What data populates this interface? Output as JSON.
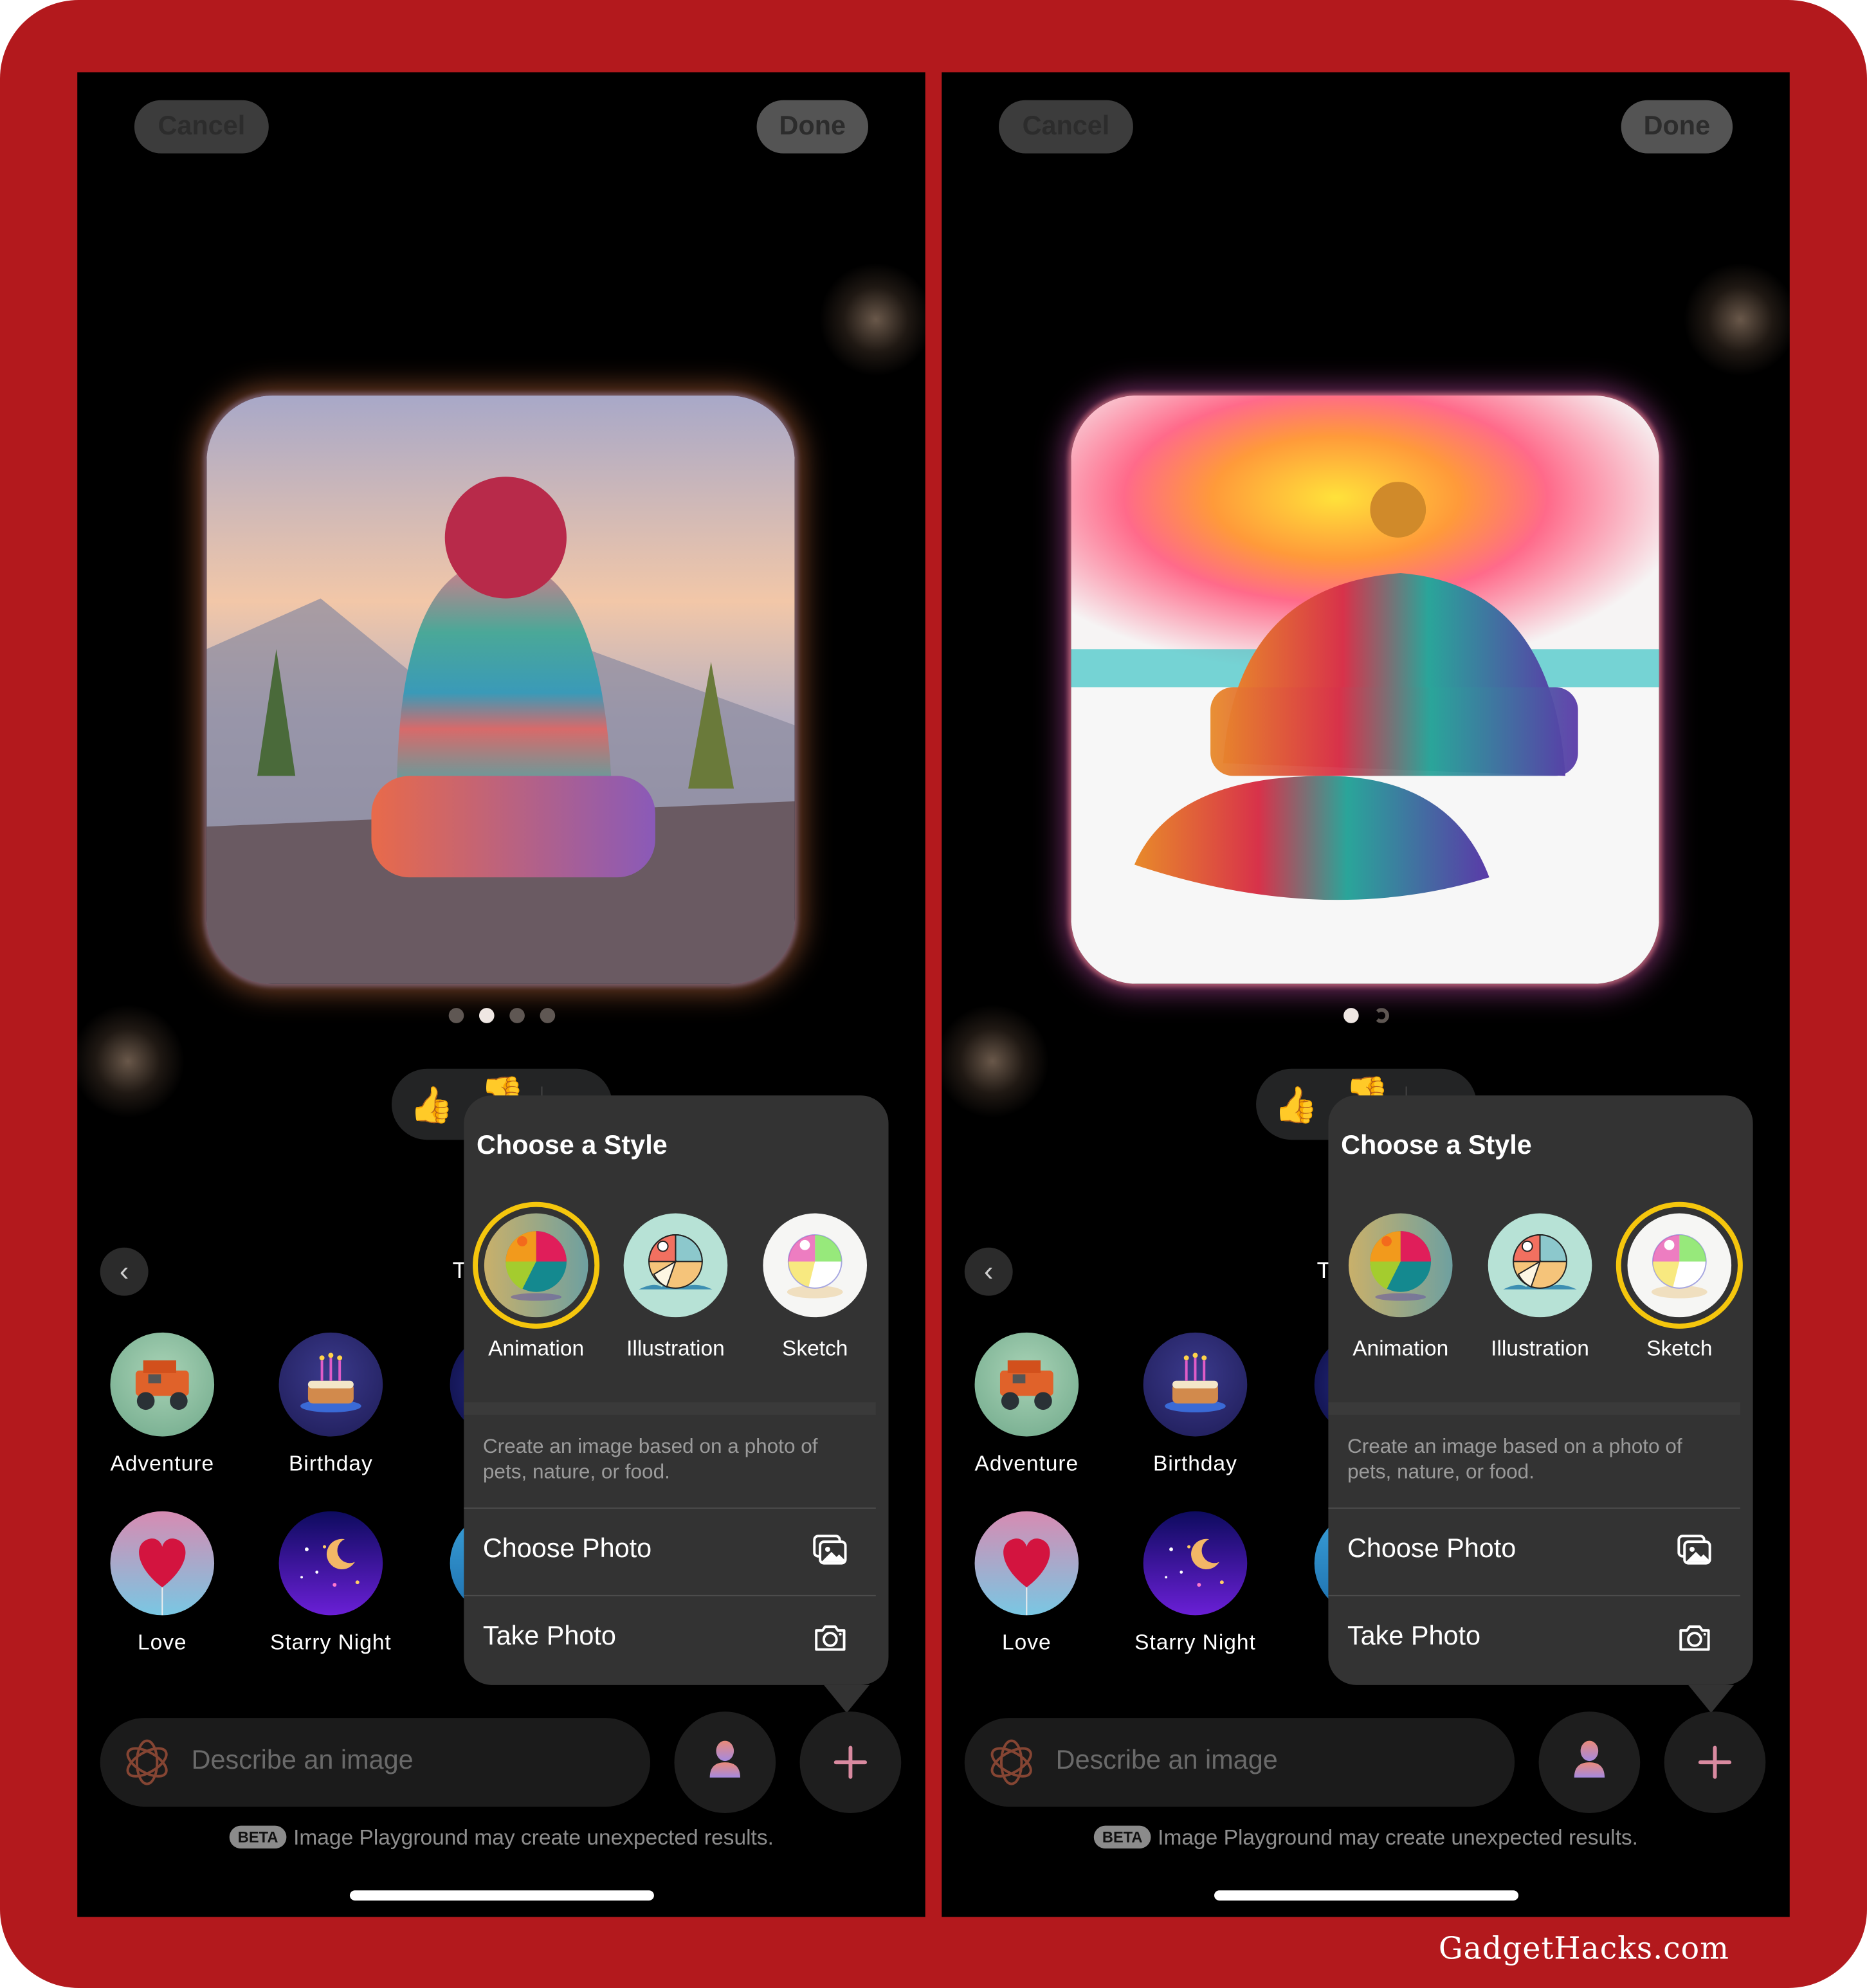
{
  "watermark": "GadgetHacks.com",
  "colors": {
    "frame": "#b3191d",
    "selection_ring": "#f5c60d",
    "popover_bg": "#333333"
  },
  "screens": [
    {
      "id": "left",
      "top_bar": {
        "cancel_label": "Cancel",
        "done_label": "Done"
      },
      "generated_image": {
        "subject": "knitted beanie with pom-pom on wooden table, mountain sunset",
        "style": "Animation"
      },
      "pager": {
        "count": 4,
        "active_index": 1,
        "loading": false
      },
      "feedback": {
        "like_icon": "thumbs-up-icon",
        "dislike_icon": "thumbs-down-icon"
      },
      "category_partial_label": "T",
      "themes": [
        {
          "label": "Adventure"
        },
        {
          "label": "Birthday"
        },
        {
          "label": "Love"
        },
        {
          "label": "Starry Night"
        }
      ],
      "popover": {
        "title": "Choose a Style",
        "styles": [
          {
            "label": "Animation",
            "selected": true
          },
          {
            "label": "Illustration",
            "selected": false
          },
          {
            "label": "Sketch",
            "selected": false
          }
        ],
        "description": "Create an image based on a photo of pets, nature, or food.",
        "actions": [
          {
            "label": "Choose Photo",
            "icon": "photo-library-icon"
          },
          {
            "label": "Take Photo",
            "icon": "camera-icon"
          }
        ]
      },
      "prompt": {
        "placeholder": "Describe an image"
      },
      "beta_badge": "BETA",
      "disclaimer": "Image Playground may create unexpected results."
    },
    {
      "id": "right",
      "top_bar": {
        "cancel_label": "Cancel",
        "done_label": "Done"
      },
      "generated_image": {
        "subject": "knitted rainbow cap on beach with sunburst",
        "style": "Sketch"
      },
      "pager": {
        "count": 2,
        "active_index": 0,
        "loading": true
      },
      "feedback": {
        "like_icon": "thumbs-up-icon",
        "dislike_icon": "thumbs-down-icon"
      },
      "category_partial_label": "T",
      "themes": [
        {
          "label": "Adventure"
        },
        {
          "label": "Birthday"
        },
        {
          "label": "Love"
        },
        {
          "label": "Starry Night"
        }
      ],
      "popover": {
        "title": "Choose a Style",
        "styles": [
          {
            "label": "Animation",
            "selected": false
          },
          {
            "label": "Illustration",
            "selected": false
          },
          {
            "label": "Sketch",
            "selected": true
          }
        ],
        "description": "Create an image based on a photo of pets, nature, or food.",
        "actions": [
          {
            "label": "Choose Photo",
            "icon": "photo-library-icon"
          },
          {
            "label": "Take Photo",
            "icon": "camera-icon"
          }
        ]
      },
      "prompt": {
        "placeholder": "Describe an image"
      },
      "beta_badge": "BETA",
      "disclaimer": "Image Playground may create unexpected results."
    }
  ]
}
